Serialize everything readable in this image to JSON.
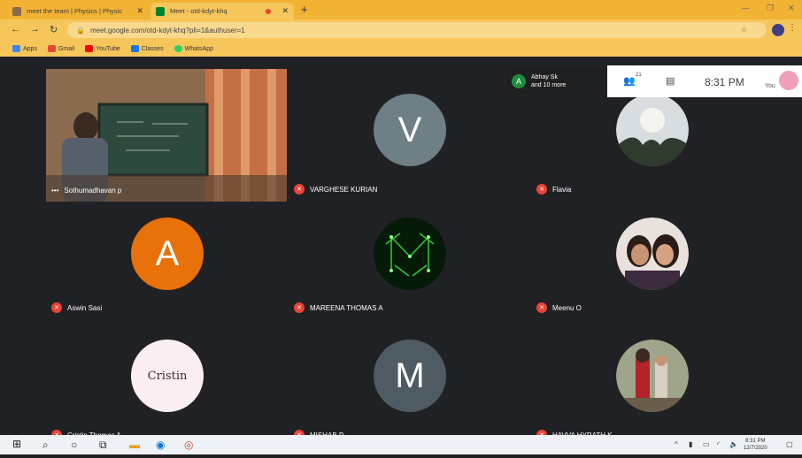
{
  "browser": {
    "tabs": [
      {
        "title": "meet the team | Physics | Physic",
        "icon": "site-favicon"
      },
      {
        "title": "Meet - otd-kdyt-khq",
        "icon": "meet-favicon",
        "recording": true
      }
    ],
    "new_tab_label": "+",
    "url": "meet.google.com/otd-kdyt-khq?pli=1&authuser=1",
    "bookmarks": [
      "Apps",
      "Gmail",
      "YouTube",
      "Classes",
      "WhatsApp"
    ]
  },
  "meet": {
    "presenter": {
      "initial": "A",
      "line1": "Abhay Sk",
      "line2": "and 10 more"
    },
    "participant_count": "21",
    "time": "8:31 PM",
    "self_label": "You",
    "participants": [
      {
        "name": "Sothumadhavan p",
        "type": "video"
      },
      {
        "name": "VARGHESE KURIAN",
        "type": "initial",
        "initial": "V",
        "color": "#6e7f86"
      },
      {
        "name": "Flavia",
        "type": "photo"
      },
      {
        "name": "Aswin Sasi",
        "type": "initial",
        "initial": "A",
        "color": "#e8710a"
      },
      {
        "name": "MAREENA THOMAS A",
        "type": "photo"
      },
      {
        "name": "Meenu O",
        "type": "photo"
      },
      {
        "name": "Cristin Thomas A",
        "type": "text-avatar",
        "text": "Cristin"
      },
      {
        "name": "MISHAB P",
        "type": "initial",
        "initial": "M",
        "color": "#4f5b62"
      },
      {
        "name": "HAVVA HYRATH K..",
        "type": "photo"
      }
    ]
  },
  "taskbar": {
    "clock_time": "8:31 PM",
    "clock_date": "12/7/2020"
  }
}
